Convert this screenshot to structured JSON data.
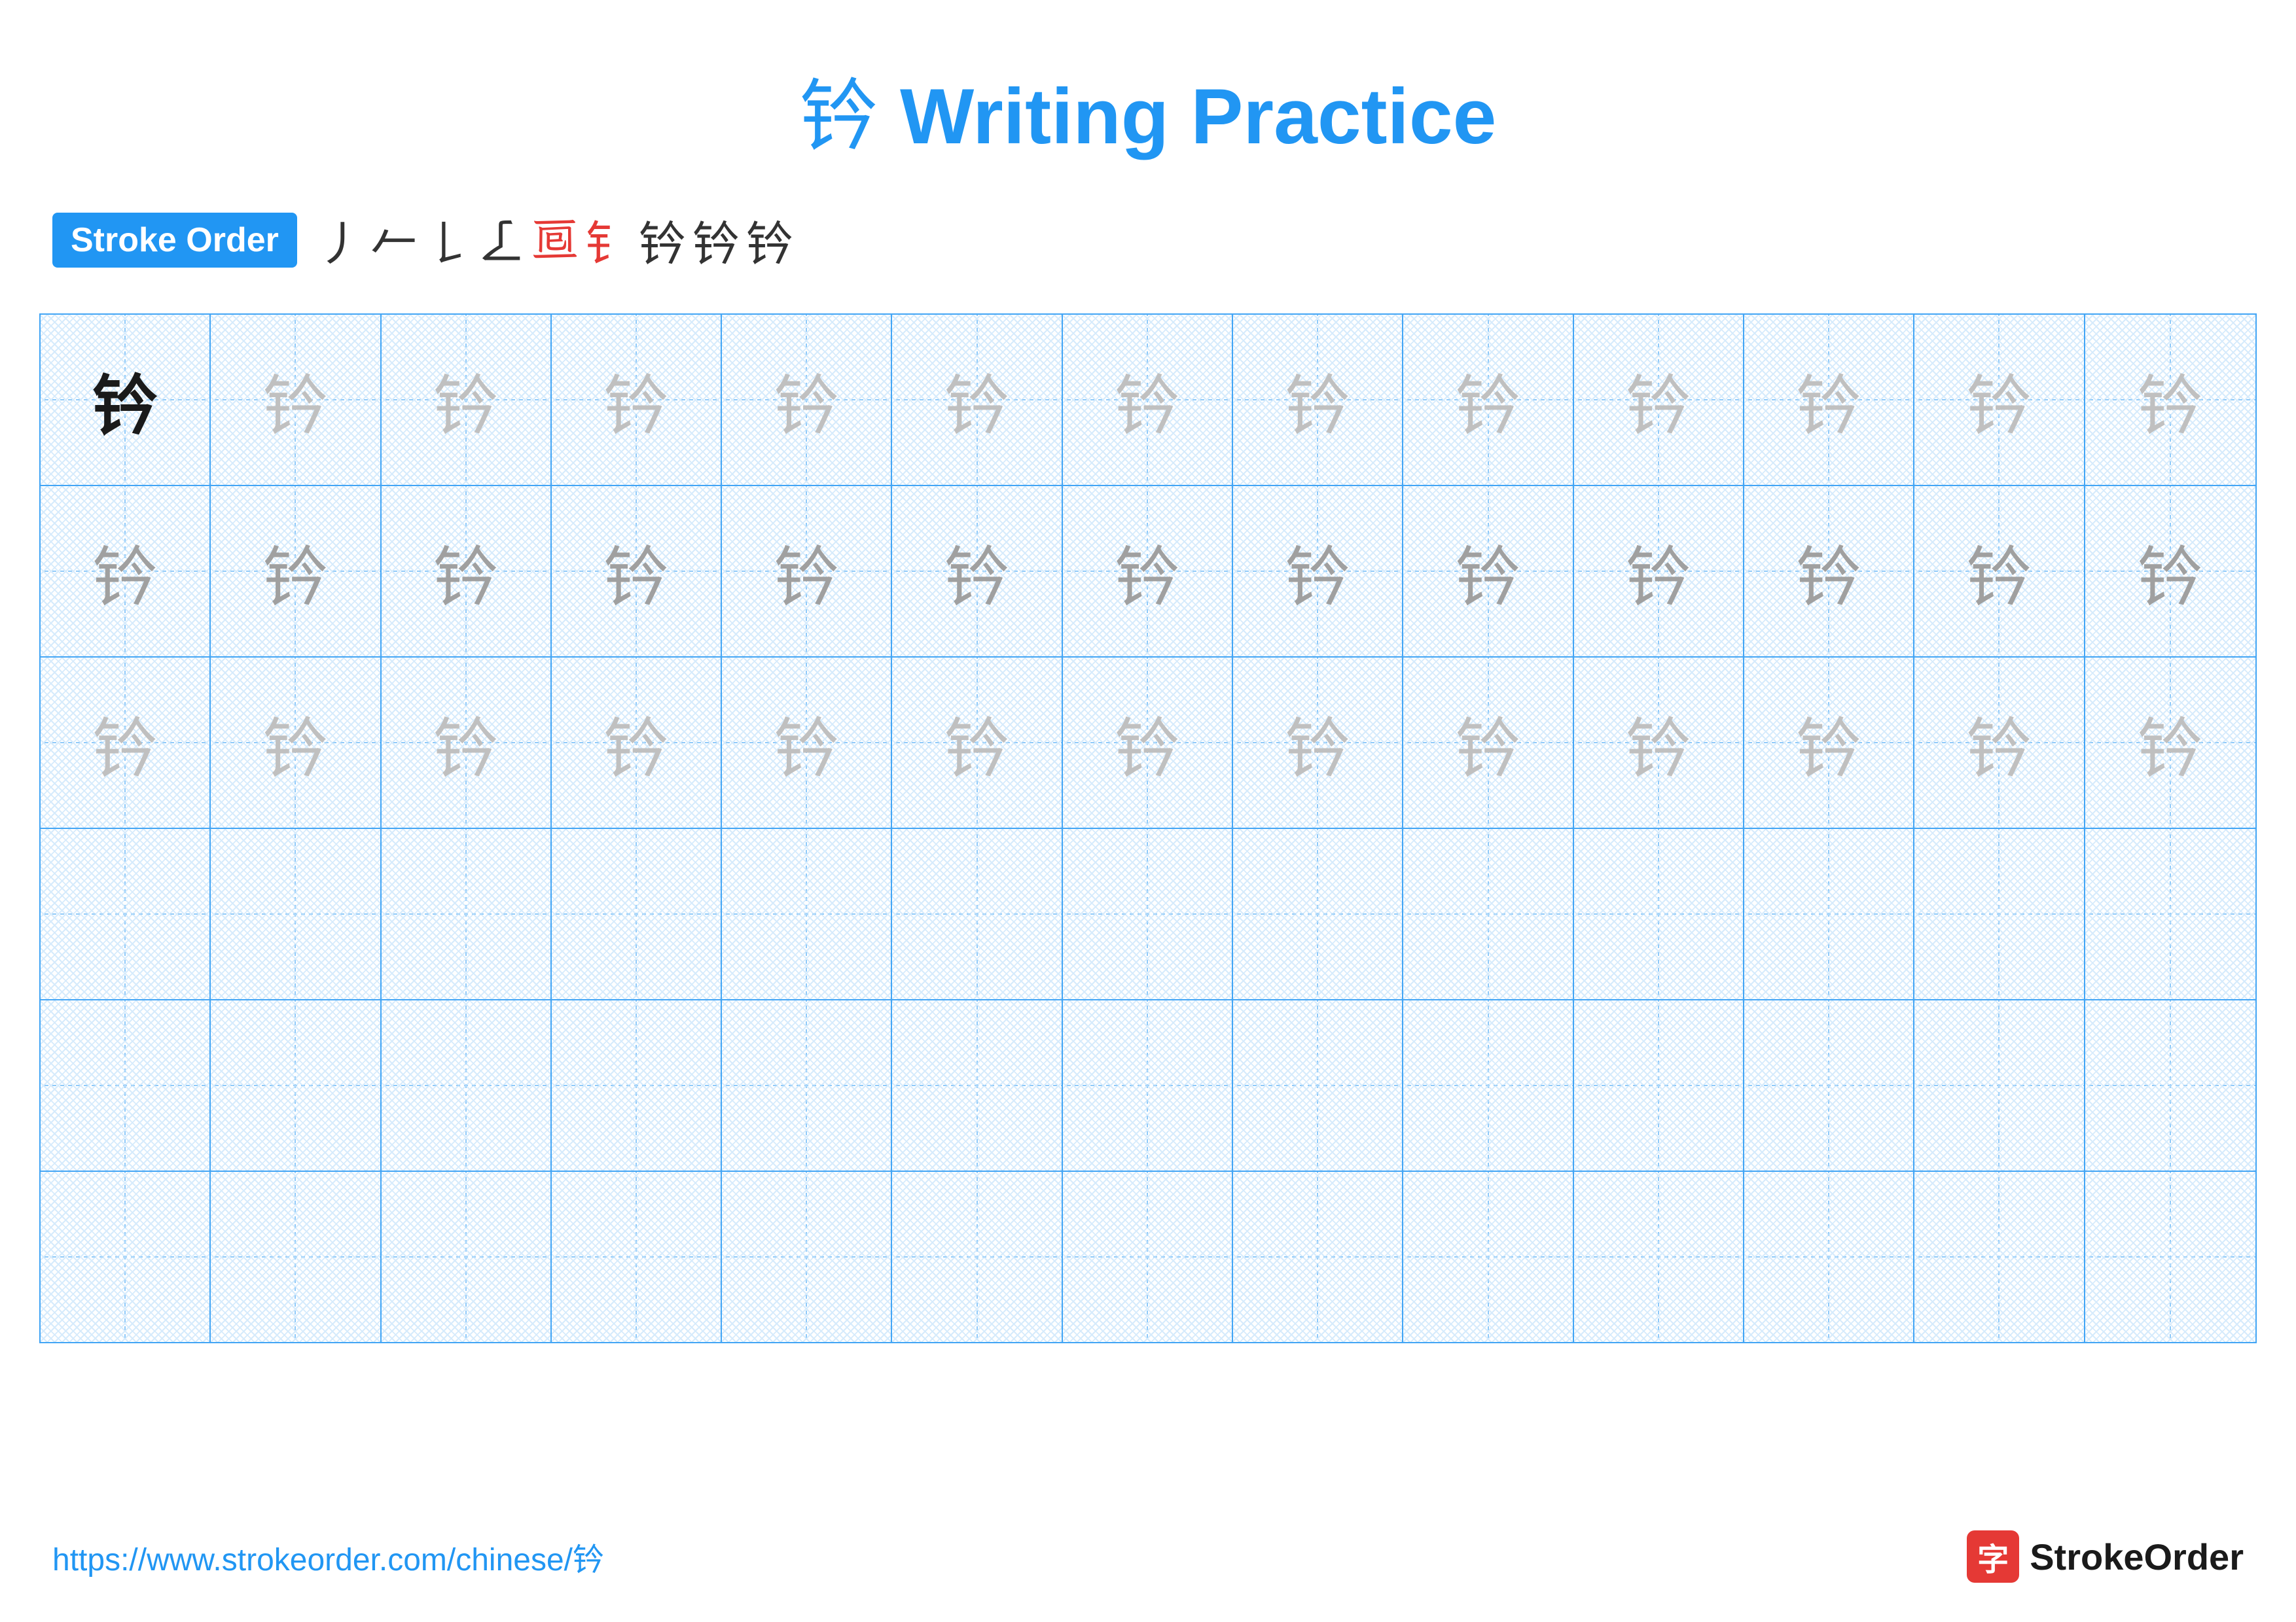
{
  "page": {
    "title": {
      "char": "钤",
      "text": " Writing Practice"
    },
    "stroke_order": {
      "badge_label": "Stroke Order",
      "strokes": [
        "丿",
        "𠂉",
        "𠄌",
        "𠄏",
        "𠄢",
        "钅",
        "钤",
        "钤",
        "钤"
      ]
    },
    "grid": {
      "rows": 6,
      "cols": 13,
      "char": "钤",
      "row_patterns": [
        [
          "dark",
          "light",
          "light",
          "light",
          "light",
          "light",
          "light",
          "light",
          "light",
          "light",
          "light",
          "light",
          "light"
        ],
        [
          "light",
          "light",
          "light",
          "light",
          "light",
          "light",
          "light",
          "light",
          "light",
          "light",
          "light",
          "light",
          "light"
        ],
        [
          "light",
          "light",
          "light",
          "light",
          "light",
          "light",
          "light",
          "light",
          "light",
          "light",
          "light",
          "light",
          "light"
        ],
        [
          "none",
          "none",
          "none",
          "none",
          "none",
          "none",
          "none",
          "none",
          "none",
          "none",
          "none",
          "none",
          "none"
        ],
        [
          "none",
          "none",
          "none",
          "none",
          "none",
          "none",
          "none",
          "none",
          "none",
          "none",
          "none",
          "none",
          "none"
        ],
        [
          "none",
          "none",
          "none",
          "none",
          "none",
          "none",
          "none",
          "none",
          "none",
          "none",
          "none",
          "none",
          "none"
        ]
      ]
    },
    "footer": {
      "url": "https://www.strokeorder.com/chinese/钤",
      "logo_text": "StrokeOrder",
      "logo_char": "字"
    }
  }
}
